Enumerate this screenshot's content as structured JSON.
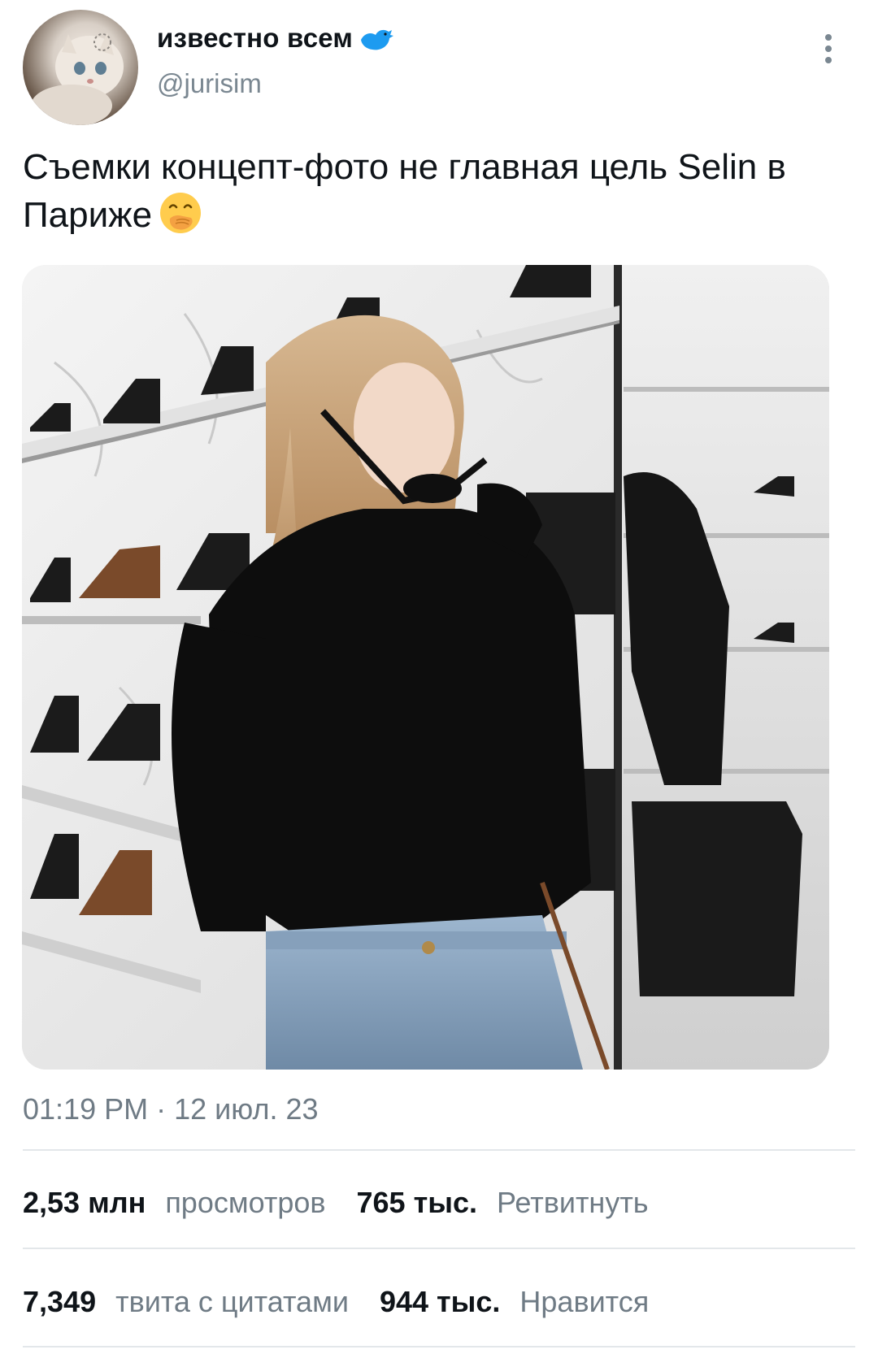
{
  "author": {
    "display_name": "известно всем",
    "handle": "@jurisim",
    "verified_icon": "blue-bird-icon"
  },
  "tweet": {
    "text": "Съемки концепт-фото не главная цель Selin в Париже",
    "emoji": "face-with-hand-over-mouth-emoji",
    "media_alt": "photo"
  },
  "meta": {
    "timestamp": "01:19 PM · 12 июл. 23"
  },
  "stats": {
    "views_count": "2,53 млн",
    "views_label": "просмотров",
    "retweets_count": "765 тыс.",
    "retweets_label": "Ретвитнуть",
    "quotes_count": "7,349",
    "quotes_label": "твита с цитатами",
    "likes_count": "944 тыс.",
    "likes_label": "Нравится"
  },
  "colors": {
    "text_primary": "#0f1419",
    "text_secondary": "#6f7b85",
    "divider": "#e3e7ea",
    "bird_blue": "#1d9bf0",
    "emoji_yellow": "#ffcc4d"
  }
}
